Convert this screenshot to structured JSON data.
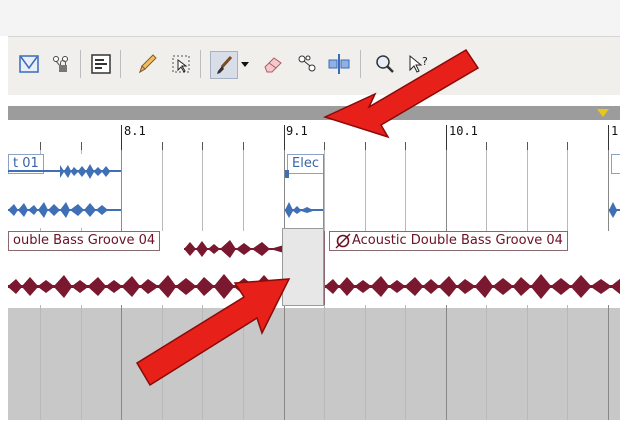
{
  "colors": {
    "audio_blue": "#3f6fb5",
    "audio_red": "#7a1830",
    "arrow_red": "#e8201a",
    "ruler_bar": "#9c9c9c",
    "loop_marker": "#e8c814",
    "lanes_bg": "#c8c8c8"
  },
  "toolbar": {
    "tools": [
      {
        "icon": "envelope-tool-icon"
      },
      {
        "icon": "lock-node-icon"
      },
      {
        "icon": "inspector-icon"
      },
      {
        "icon": "pencil-icon"
      },
      {
        "icon": "select-tool-icon"
      },
      {
        "icon": "paintbrush-icon"
      },
      {
        "icon": "dropdown-arrow-icon"
      },
      {
        "icon": "eraser-icon"
      },
      {
        "icon": "split-nodes-icon"
      },
      {
        "icon": "split-tool-icon"
      },
      {
        "icon": "zoom-tool-icon"
      },
      {
        "icon": "help-cursor-icon"
      }
    ]
  },
  "ruler": {
    "marks": [
      "8.1",
      "9.1",
      "10.1",
      "1"
    ]
  },
  "tracks": [
    {
      "clips": [
        {
          "label": "t 01"
        },
        {
          "label": "Elec"
        },
        {
          "label": ""
        }
      ]
    },
    {
      "clips": [
        {
          "label": "ouble Bass Groove 04"
        },
        {
          "label": "Acoustic Double Bass Groove 04"
        }
      ]
    }
  ],
  "annotations": {
    "arrow_count": 2
  }
}
